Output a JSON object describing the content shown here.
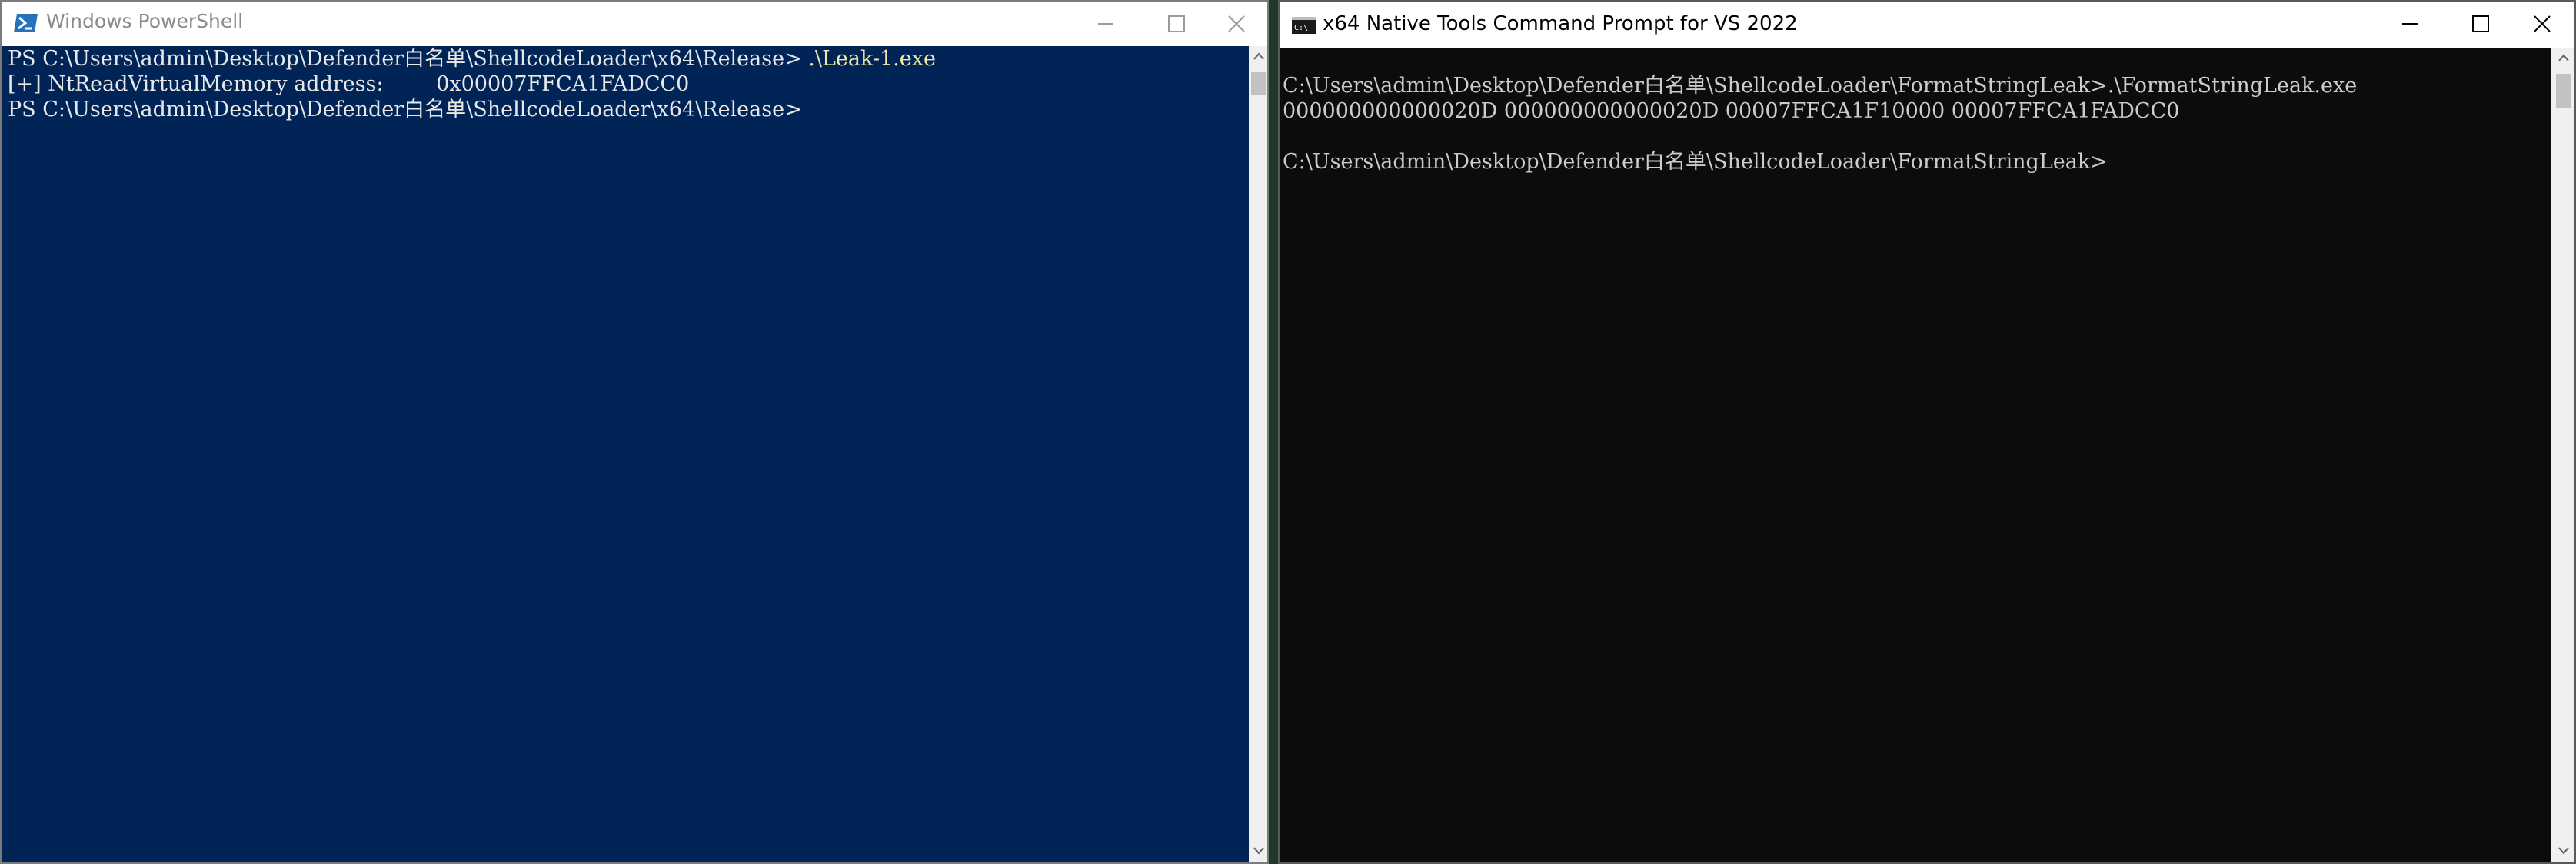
{
  "powershell": {
    "title": "Windows PowerShell",
    "title_icon": "powershell-icon",
    "lines": [
      {
        "prompt": "PS C:\\Users\\admin\\Desktop\\Defender白名单\\ShellcodeLoader\\x64\\Release> ",
        "command": ".\\Leak-1.exe"
      },
      {
        "text": "[+] NtReadVirtualMemory address:        0x00007FFCA1FADCC0"
      },
      {
        "prompt": "PS C:\\Users\\admin\\Desktop\\Defender白名单\\ShellcodeLoader\\x64\\Release> ",
        "command": ""
      }
    ],
    "colors": {
      "background": "#012456",
      "text": "#e8e8e8",
      "command": "#f3e9a8"
    }
  },
  "cmd": {
    "title": "x64 Native Tools Command Prompt for VS 2022",
    "title_icon": "cmd-icon",
    "lines": [
      "",
      "C:\\Users\\admin\\Desktop\\Defender白名单\\ShellcodeLoader\\FormatStringLeak>.\\FormatStringLeak.exe",
      "000000000000020D 000000000000020D 00007FFCA1F10000 00007FFCA1FADCC0",
      "",
      "C:\\Users\\admin\\Desktop\\Defender白名单\\ShellcodeLoader\\FormatStringLeak>"
    ],
    "colors": {
      "background": "#0c0c0c",
      "text": "#cccccc"
    }
  }
}
